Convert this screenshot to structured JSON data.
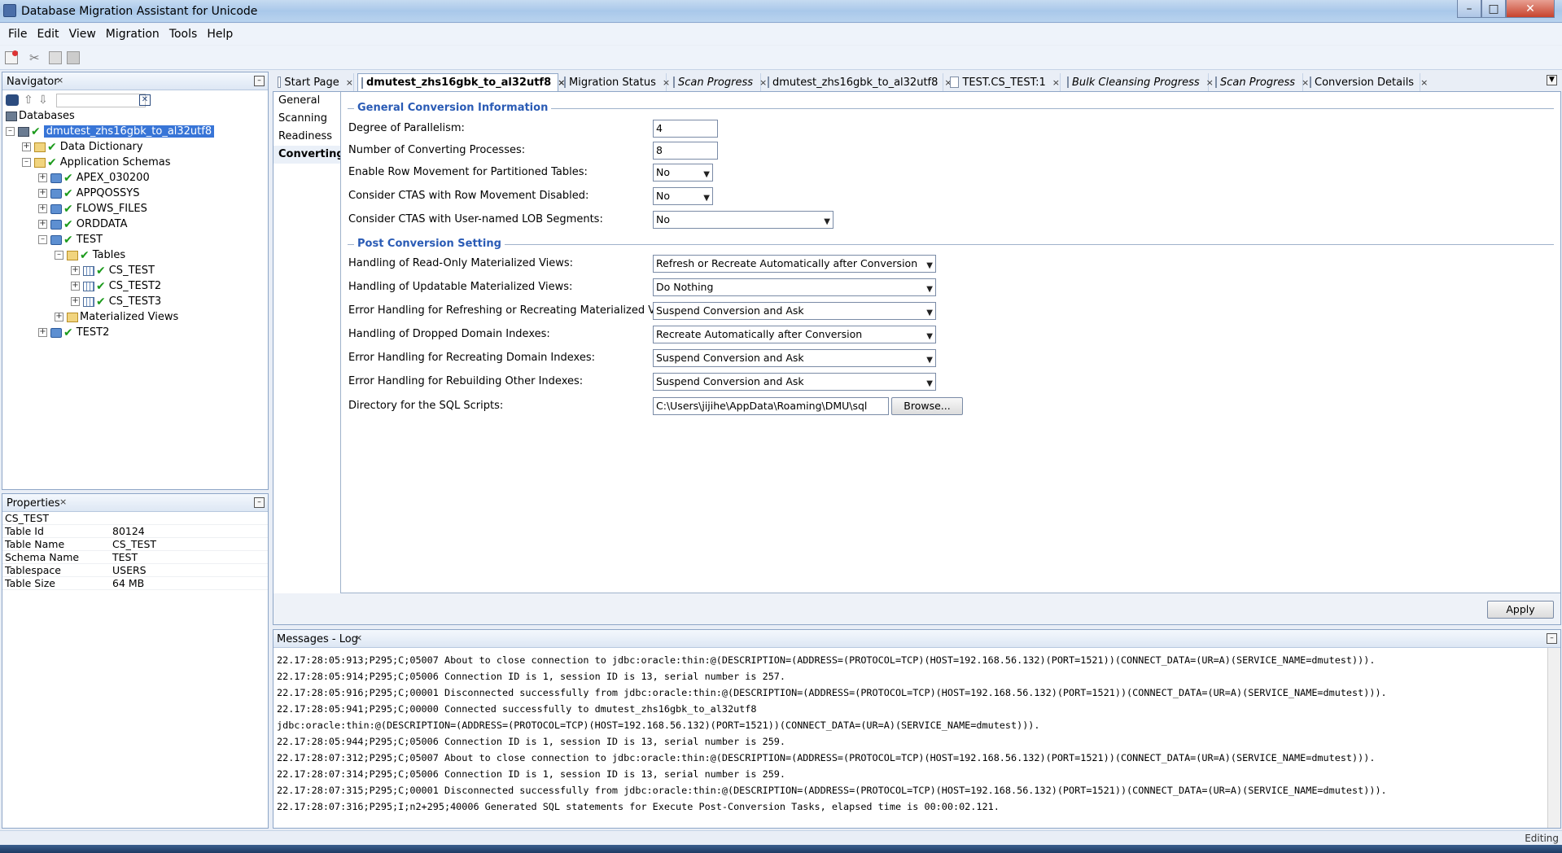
{
  "window": {
    "title": "Database Migration Assistant for Unicode"
  },
  "menu": [
    "File",
    "Edit",
    "View",
    "Migration",
    "Tools",
    "Help"
  ],
  "navigator": {
    "label": "Navigator",
    "root": "Databases",
    "nodes": [
      {
        "label": "dmutest_zhs16gbk_to_al32utf8"
      },
      {
        "label": "Data Dictionary"
      },
      {
        "label": "Application Schemas"
      },
      {
        "label": "APEX_030200"
      },
      {
        "label": "APPQOSSYS"
      },
      {
        "label": "FLOWS_FILES"
      },
      {
        "label": "ORDDATA"
      },
      {
        "label": "TEST"
      },
      {
        "label": "Tables"
      },
      {
        "label": "CS_TEST"
      },
      {
        "label": "CS_TEST2"
      },
      {
        "label": "CS_TEST3"
      },
      {
        "label": "Materialized Views"
      },
      {
        "label": "TEST2"
      }
    ]
  },
  "properties": {
    "label": "Properties",
    "object": "CS_TEST",
    "rows": [
      {
        "k": "Table Id",
        "v": "80124"
      },
      {
        "k": "Table Name",
        "v": "CS_TEST"
      },
      {
        "k": "Schema Name",
        "v": "TEST"
      },
      {
        "k": "Tablespace",
        "v": "USERS"
      },
      {
        "k": "Table Size",
        "v": "64 MB"
      }
    ]
  },
  "tabs": [
    {
      "label": "Start Page"
    },
    {
      "label": "dmutest_zhs16gbk_to_al32utf8"
    },
    {
      "label": "Migration Status"
    },
    {
      "label": "Scan Progress"
    },
    {
      "label": "dmutest_zhs16gbk_to_al32utf8"
    },
    {
      "label": "TEST.CS_TEST:1"
    },
    {
      "label": "Bulk Cleansing Progress"
    },
    {
      "label": "Scan Progress"
    },
    {
      "label": "Conversion Details"
    }
  ],
  "sidenav": [
    "General",
    "Scanning",
    "Readiness",
    "Converting"
  ],
  "general": {
    "title": "General Conversion Information",
    "parallelism_label": "Degree of Parallelism:",
    "parallelism": "4",
    "processes_label": "Number of Converting Processes:",
    "processes": "8",
    "row_movement_label": "Enable Row Movement for Partitioned Tables:",
    "row_movement": "No",
    "ctas_label": "Consider CTAS with Row Movement Disabled:",
    "ctas": "No",
    "lob_label": "Consider CTAS with User-named LOB Segments:",
    "lob": "No"
  },
  "post": {
    "title": "Post Conversion Setting",
    "ro_mv_label": "Handling of Read-Only Materialized Views:",
    "ro_mv": "Refresh or Recreate Automatically after Conversion",
    "up_mv_label": "Handling of Updatable Materialized Views:",
    "up_mv": "Do Nothing",
    "err_mv_label": "Error Handling for Refreshing or Recreating Materialized Views:",
    "err_mv": "Suspend Conversion and Ask",
    "dom_idx_label": "Handling of Dropped Domain Indexes:",
    "dom_idx": "Recreate Automatically after Conversion",
    "err_dom_label": "Error Handling for Recreating Domain Indexes:",
    "err_dom": "Suspend Conversion and Ask",
    "err_other_label": "Error Handling for Rebuilding Other Indexes:",
    "err_other": "Suspend Conversion and Ask",
    "dir_label": "Directory for the SQL Scripts:",
    "dir": "C:\\Users\\jijihe\\AppData\\Roaming\\DMU\\sql",
    "browse": "Browse..."
  },
  "apply": "Apply",
  "messages": {
    "label": "Messages - Log",
    "lines": [
      "22.17:28:05:913;P295;C;05007 About to close connection to jdbc:oracle:thin:@(DESCRIPTION=(ADDRESS=(PROTOCOL=TCP)(HOST=192.168.56.132)(PORT=1521))(CONNECT_DATA=(UR=A)(SERVICE_NAME=dmutest))).",
      "22.17:28:05:914;P295;C;05006 Connection ID is 1, session ID is 13, serial number is 257.",
      "22.17:28:05:916;P295;C;00001 Disconnected successfully from jdbc:oracle:thin:@(DESCRIPTION=(ADDRESS=(PROTOCOL=TCP)(HOST=192.168.56.132)(PORT=1521))(CONNECT_DATA=(UR=A)(SERVICE_NAME=dmutest))).",
      "22.17:28:05:941;P295;C;00000 Connected successfully to dmutest_zhs16gbk_to_al32utf8",
      "jdbc:oracle:thin:@(DESCRIPTION=(ADDRESS=(PROTOCOL=TCP)(HOST=192.168.56.132)(PORT=1521))(CONNECT_DATA=(UR=A)(SERVICE_NAME=dmutest))).",
      "22.17:28:05:944;P295;C;05006 Connection ID is 1, session ID is 13, serial number is 259.",
      "22.17:28:07:312;P295;C;05007 About to close connection to jdbc:oracle:thin:@(DESCRIPTION=(ADDRESS=(PROTOCOL=TCP)(HOST=192.168.56.132)(PORT=1521))(CONNECT_DATA=(UR=A)(SERVICE_NAME=dmutest))).",
      "22.17:28:07:314;P295;C;05006 Connection ID is 1, session ID is 13, serial number is 259.",
      "22.17:28:07:315;P295;C;00001 Disconnected successfully from jdbc:oracle:thin:@(DESCRIPTION=(ADDRESS=(PROTOCOL=TCP)(HOST=192.168.56.132)(PORT=1521))(CONNECT_DATA=(UR=A)(SERVICE_NAME=dmutest))).",
      "22.17:28:07:316;P295;I;n2+295;40006 Generated SQL statements for Execute Post-Conversion Tasks, elapsed time is 00:00:02.121."
    ]
  },
  "status": {
    "mode": "Editing"
  }
}
